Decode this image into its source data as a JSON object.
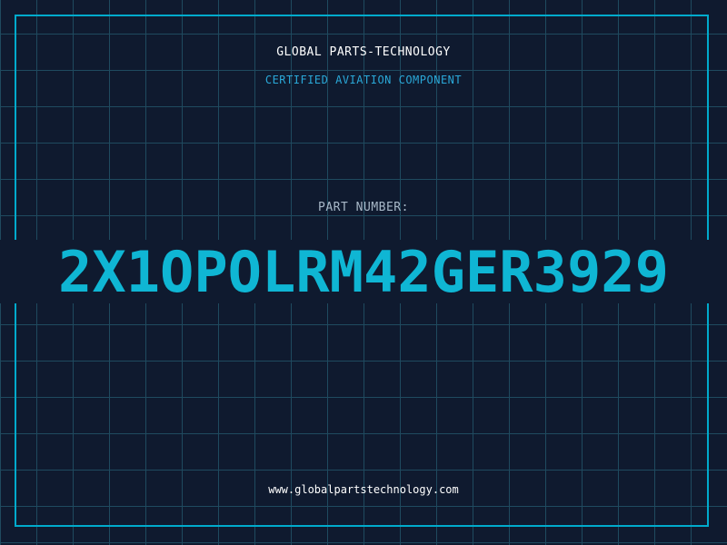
{
  "header": {
    "company": "GLOBAL PARTS-TECHNOLOGY",
    "subtitle": "CERTIFIED AVIATION COMPONENT"
  },
  "part": {
    "label": "PART NUMBER:",
    "number": "2X1OPOLRM42GER3929"
  },
  "footer": {
    "website": "www.globalpartstechnology.com"
  },
  "colors": {
    "background": "#0f1a2f",
    "grid": "#1f4a5f",
    "accent": "#00aacc",
    "part_number": "#0fb6d4"
  }
}
